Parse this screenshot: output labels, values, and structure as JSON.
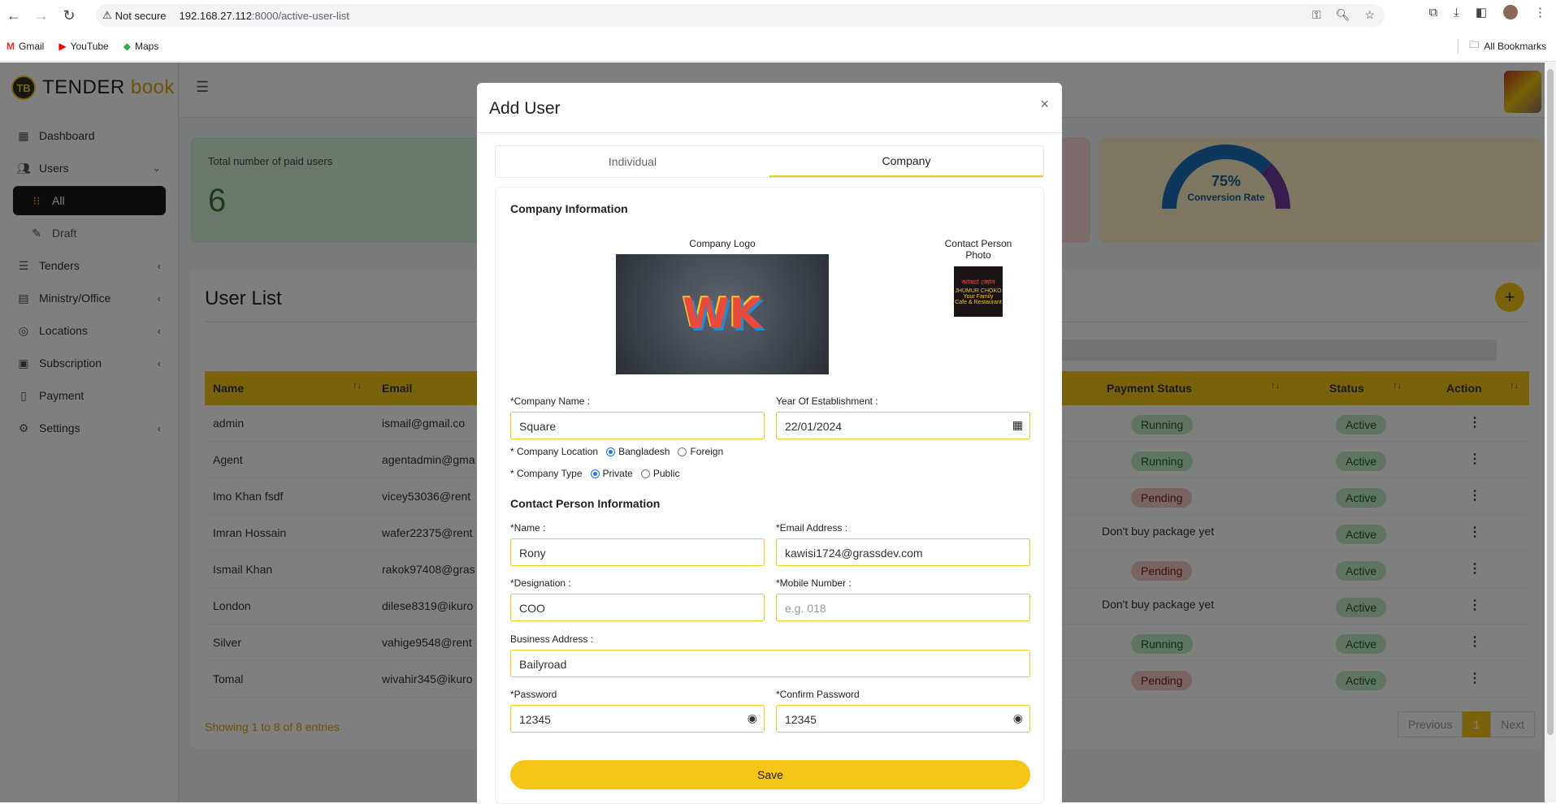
{
  "browser": {
    "security_label": "Not secure",
    "url_host": "192.168.27.112",
    "url_rest": ":8000/active-user-list",
    "bookmarks": [
      "Gmail",
      "YouTube",
      "Maps"
    ],
    "all_bookmarks": "All Bookmarks"
  },
  "app": {
    "logo_badge": "TB",
    "logo_text1": "TENDER",
    "logo_text2": "book"
  },
  "sidebar": {
    "items": [
      {
        "label": "Dashboard",
        "icon": "dashboard-icon"
      },
      {
        "label": "Users",
        "icon": "users-icon"
      },
      {
        "label": "All",
        "icon": "grid-icon"
      },
      {
        "label": "Draft",
        "icon": "draft-icon"
      },
      {
        "label": "Tenders",
        "icon": "tenders-icon"
      },
      {
        "label": "Ministry/Office",
        "icon": "ministry-icon"
      },
      {
        "label": "Locations",
        "icon": "location-icon"
      },
      {
        "label": "Subscription",
        "icon": "subscription-icon"
      },
      {
        "label": "Payment",
        "icon": "payment-icon"
      },
      {
        "label": "Settings",
        "icon": "settings-icon"
      }
    ]
  },
  "stats": {
    "paid_label": "Total number of paid users",
    "paid_value": "6",
    "conversion_percent": "75%",
    "conversion_label": "Conversion Rate",
    "conversion_value": 0.75
  },
  "list": {
    "title": "User List",
    "columns": {
      "name": "Name",
      "email": "Email",
      "payment": "Payment Status",
      "status": "Status",
      "action": "Action"
    },
    "rows": [
      {
        "name": "admin",
        "email": "ismail@gmail.co",
        "payment": "Running",
        "status": "Active"
      },
      {
        "name": "Agent",
        "email": "agentadmin@gma",
        "payment": "Running",
        "status": "Active"
      },
      {
        "name": "Imo Khan fsdf",
        "email": "vicey53036@rent",
        "payment": "Pending",
        "status": "Active"
      },
      {
        "name": "Imran Hossain",
        "email": "wafer22375@rent",
        "payment": "Don't buy package yet",
        "status": "Active"
      },
      {
        "name": "Ismail Khan",
        "email": "rakok97408@gras",
        "payment": "Pending",
        "status": "Active"
      },
      {
        "name": "London",
        "email": "dilese8319@ikuro",
        "payment": "Don't buy package yet",
        "status": "Active"
      },
      {
        "name": "Silver",
        "email": "vahige9548@rent",
        "payment": "Running",
        "status": "Active"
      },
      {
        "name": "Tomal",
        "email": "wivahir345@ikuro",
        "payment": "Pending",
        "status": "Active"
      }
    ],
    "footer": "Showing 1 to 8 of 8 entries",
    "pager": {
      "prev": "Previous",
      "current": "1",
      "next": "Next"
    }
  },
  "modal": {
    "title": "Add User",
    "close": "×",
    "tabs": [
      "Individual",
      "Company"
    ],
    "company_section": "Company Information",
    "company_logo_label": "Company Logo",
    "contact_photo_label": "Contact Person Photo",
    "logo_text": "WK",
    "photo_text_1": "আড্ডা জোন",
    "photo_text_2": "JHUMUR CHOKO",
    "photo_text_3": "Your Family",
    "photo_text_4": "Cafe & Restaurant",
    "company_name_label": "*Company Name :",
    "company_name_value": "Square",
    "year_label": "Year Of Establishment :",
    "year_value": "22/01/2024",
    "location_label": "* Company Location",
    "location_opt1": "Bangladesh",
    "location_opt2": "Foreign",
    "type_label": "* Company Type",
    "type_opt1": "Private",
    "type_opt2": "Public",
    "contact_section": "Contact Person Information",
    "name_label": "*Name :",
    "name_value": "Rony",
    "email_label": "*Email Address :",
    "email_value": "kawisi1724@grassdev.com",
    "designation_label": "*Designation :",
    "designation_value": "COO",
    "mobile_label": "*Mobile Number :",
    "mobile_placeholder": "e.g. 018",
    "address_label": "Business Address :",
    "address_value": "Bailyroad",
    "password_label": "*Password",
    "password_value": "12345",
    "confirm_label": "*Confirm Password",
    "confirm_value": "12345",
    "save": "Save"
  }
}
